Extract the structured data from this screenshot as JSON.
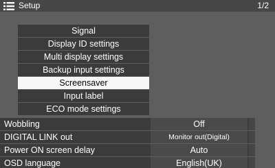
{
  "header": {
    "icon": "menu-list-icon",
    "title": "Setup",
    "page": "1/2"
  },
  "menu": {
    "items": [
      {
        "label": "Signal"
      },
      {
        "label": "Display ID settings"
      },
      {
        "label": "Multi display settings"
      },
      {
        "label": "Backup input settings"
      },
      {
        "label": "Screensaver",
        "selected": true
      },
      {
        "label": "Input label"
      },
      {
        "label": "ECO mode settings"
      }
    ]
  },
  "options": [
    {
      "label": "Wobbling",
      "value": "Off"
    },
    {
      "label": "DIGITAL LINK out",
      "value": "Monitor out(Digital)"
    },
    {
      "label": "Power ON screen delay",
      "value": "Auto"
    },
    {
      "label": "OSD language",
      "value": "English(UK)"
    }
  ],
  "colors": {
    "background": "#5e5e5e",
    "item": "#3b3b3b",
    "selected": "#f6f6f6",
    "text": "#ffffff"
  }
}
